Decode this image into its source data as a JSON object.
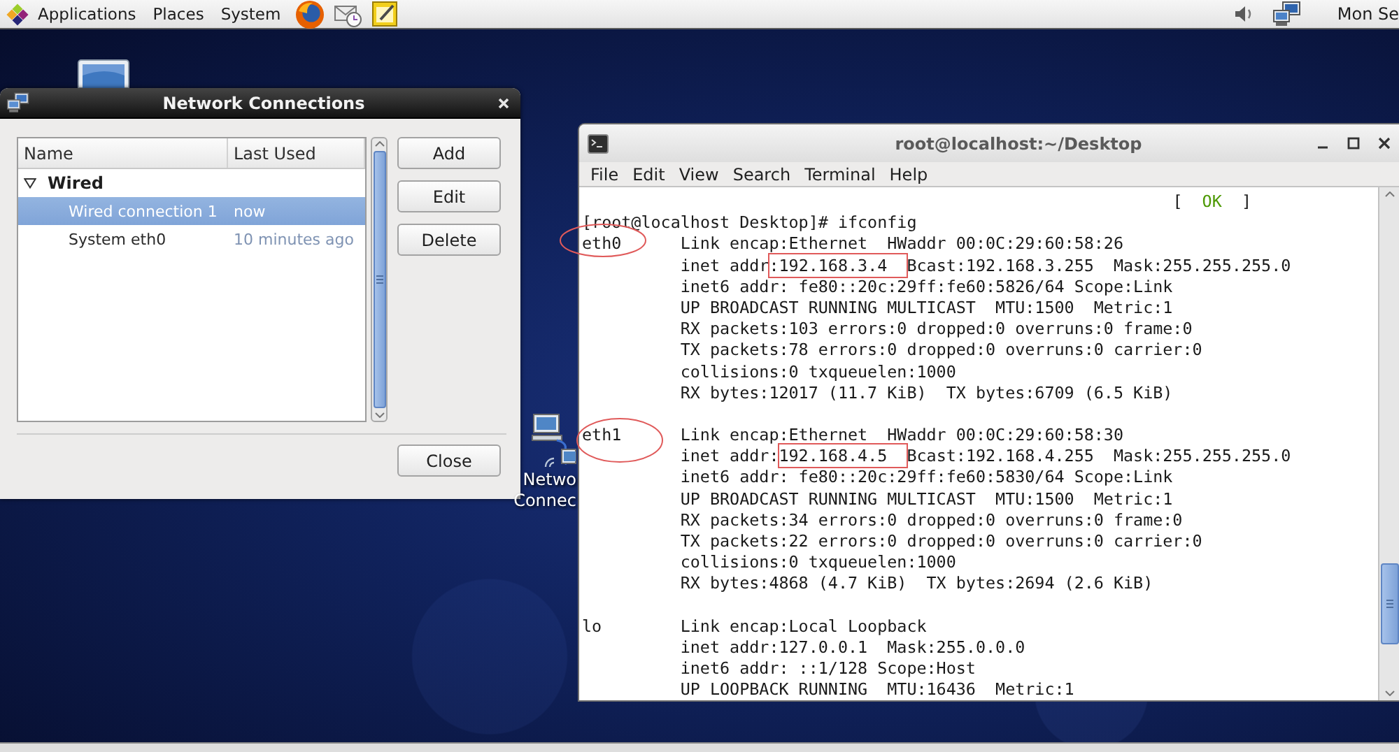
{
  "top_panel": {
    "menus": [
      "Applications",
      "Places",
      "System"
    ],
    "clock": "Mon Se"
  },
  "network_connections": {
    "title": "Network Connections",
    "columns": [
      "Name",
      "Last Used"
    ],
    "groups": [
      {
        "name": "Wired",
        "expanded": true,
        "children": [
          {
            "name": "Wired connection 1",
            "last_used": "now",
            "selected": true
          },
          {
            "name": "System eth0",
            "last_used": "10 minutes ago",
            "selected": false
          }
        ]
      }
    ],
    "buttons": [
      "Add",
      "Edit",
      "Delete"
    ],
    "close_button": "Close"
  },
  "desktop": {
    "network_icon_label": [
      "Netwo",
      "Connec"
    ]
  },
  "terminal": {
    "title": "root@localhost:~/Desktop",
    "menu": [
      "File",
      "Edit",
      "View",
      "Search",
      "Terminal",
      "Help"
    ],
    "status": {
      "open": "[",
      "label": "OK",
      "close": "]"
    },
    "prompt": "[root@localhost Desktop]# ifconfig",
    "interfaces": [
      {
        "name": "eth0",
        "lines": [
          "Link encap:Ethernet  HWaddr 00:0C:29:60:58:26",
          {
            "segments": [
              {
                "text": "inet addr",
                "boxed": false
              },
              {
                "text": ":192.168.3.4  ",
                "boxed": true
              },
              {
                "text": "Bcast:192.168.3.255  Mask:255.255.255.0",
                "boxed": false
              }
            ]
          },
          "inet6 addr: fe80::20c:29ff:fe60:5826/64 Scope:Link",
          "UP BROADCAST RUNNING MULTICAST  MTU:1500  Metric:1",
          "RX packets:103 errors:0 dropped:0 overruns:0 frame:0",
          "TX packets:78 errors:0 dropped:0 overruns:0 carrier:0",
          "collisions:0 txqueuelen:1000",
          "RX bytes:12017 (11.7 KiB)  TX bytes:6709 (6.5 KiB)"
        ]
      },
      {
        "name": "eth1",
        "lines": [
          "Link encap:Ethernet  HWaddr 00:0C:29:60:58:30",
          {
            "segments": [
              {
                "text": "inet addr:",
                "boxed": false
              },
              {
                "text": "192.168.4.5  ",
                "boxed": true
              },
              {
                "text": "Bcast:192.168.4.255  Mask:255.255.255.0",
                "boxed": false
              }
            ]
          },
          "inet6 addr: fe80::20c:29ff:fe60:5830/64 Scope:Link",
          "UP BROADCAST RUNNING MULTICAST  MTU:1500  Metric:1",
          "RX packets:34 errors:0 dropped:0 overruns:0 frame:0",
          "TX packets:22 errors:0 dropped:0 overruns:0 carrier:0",
          "collisions:0 txqueuelen:1000",
          "RX bytes:4868 (4.7 KiB)  TX bytes:2694 (2.6 KiB)"
        ]
      },
      {
        "name": "lo",
        "lines": [
          "Link encap:Local Loopback",
          "inet addr:127.0.0.1  Mask:255.0.0.0",
          "inet6 addr: ::1/128 Scope:Host",
          "UP LOOPBACK RUNNING  MTU:16436  Metric:1"
        ]
      }
    ]
  }
}
